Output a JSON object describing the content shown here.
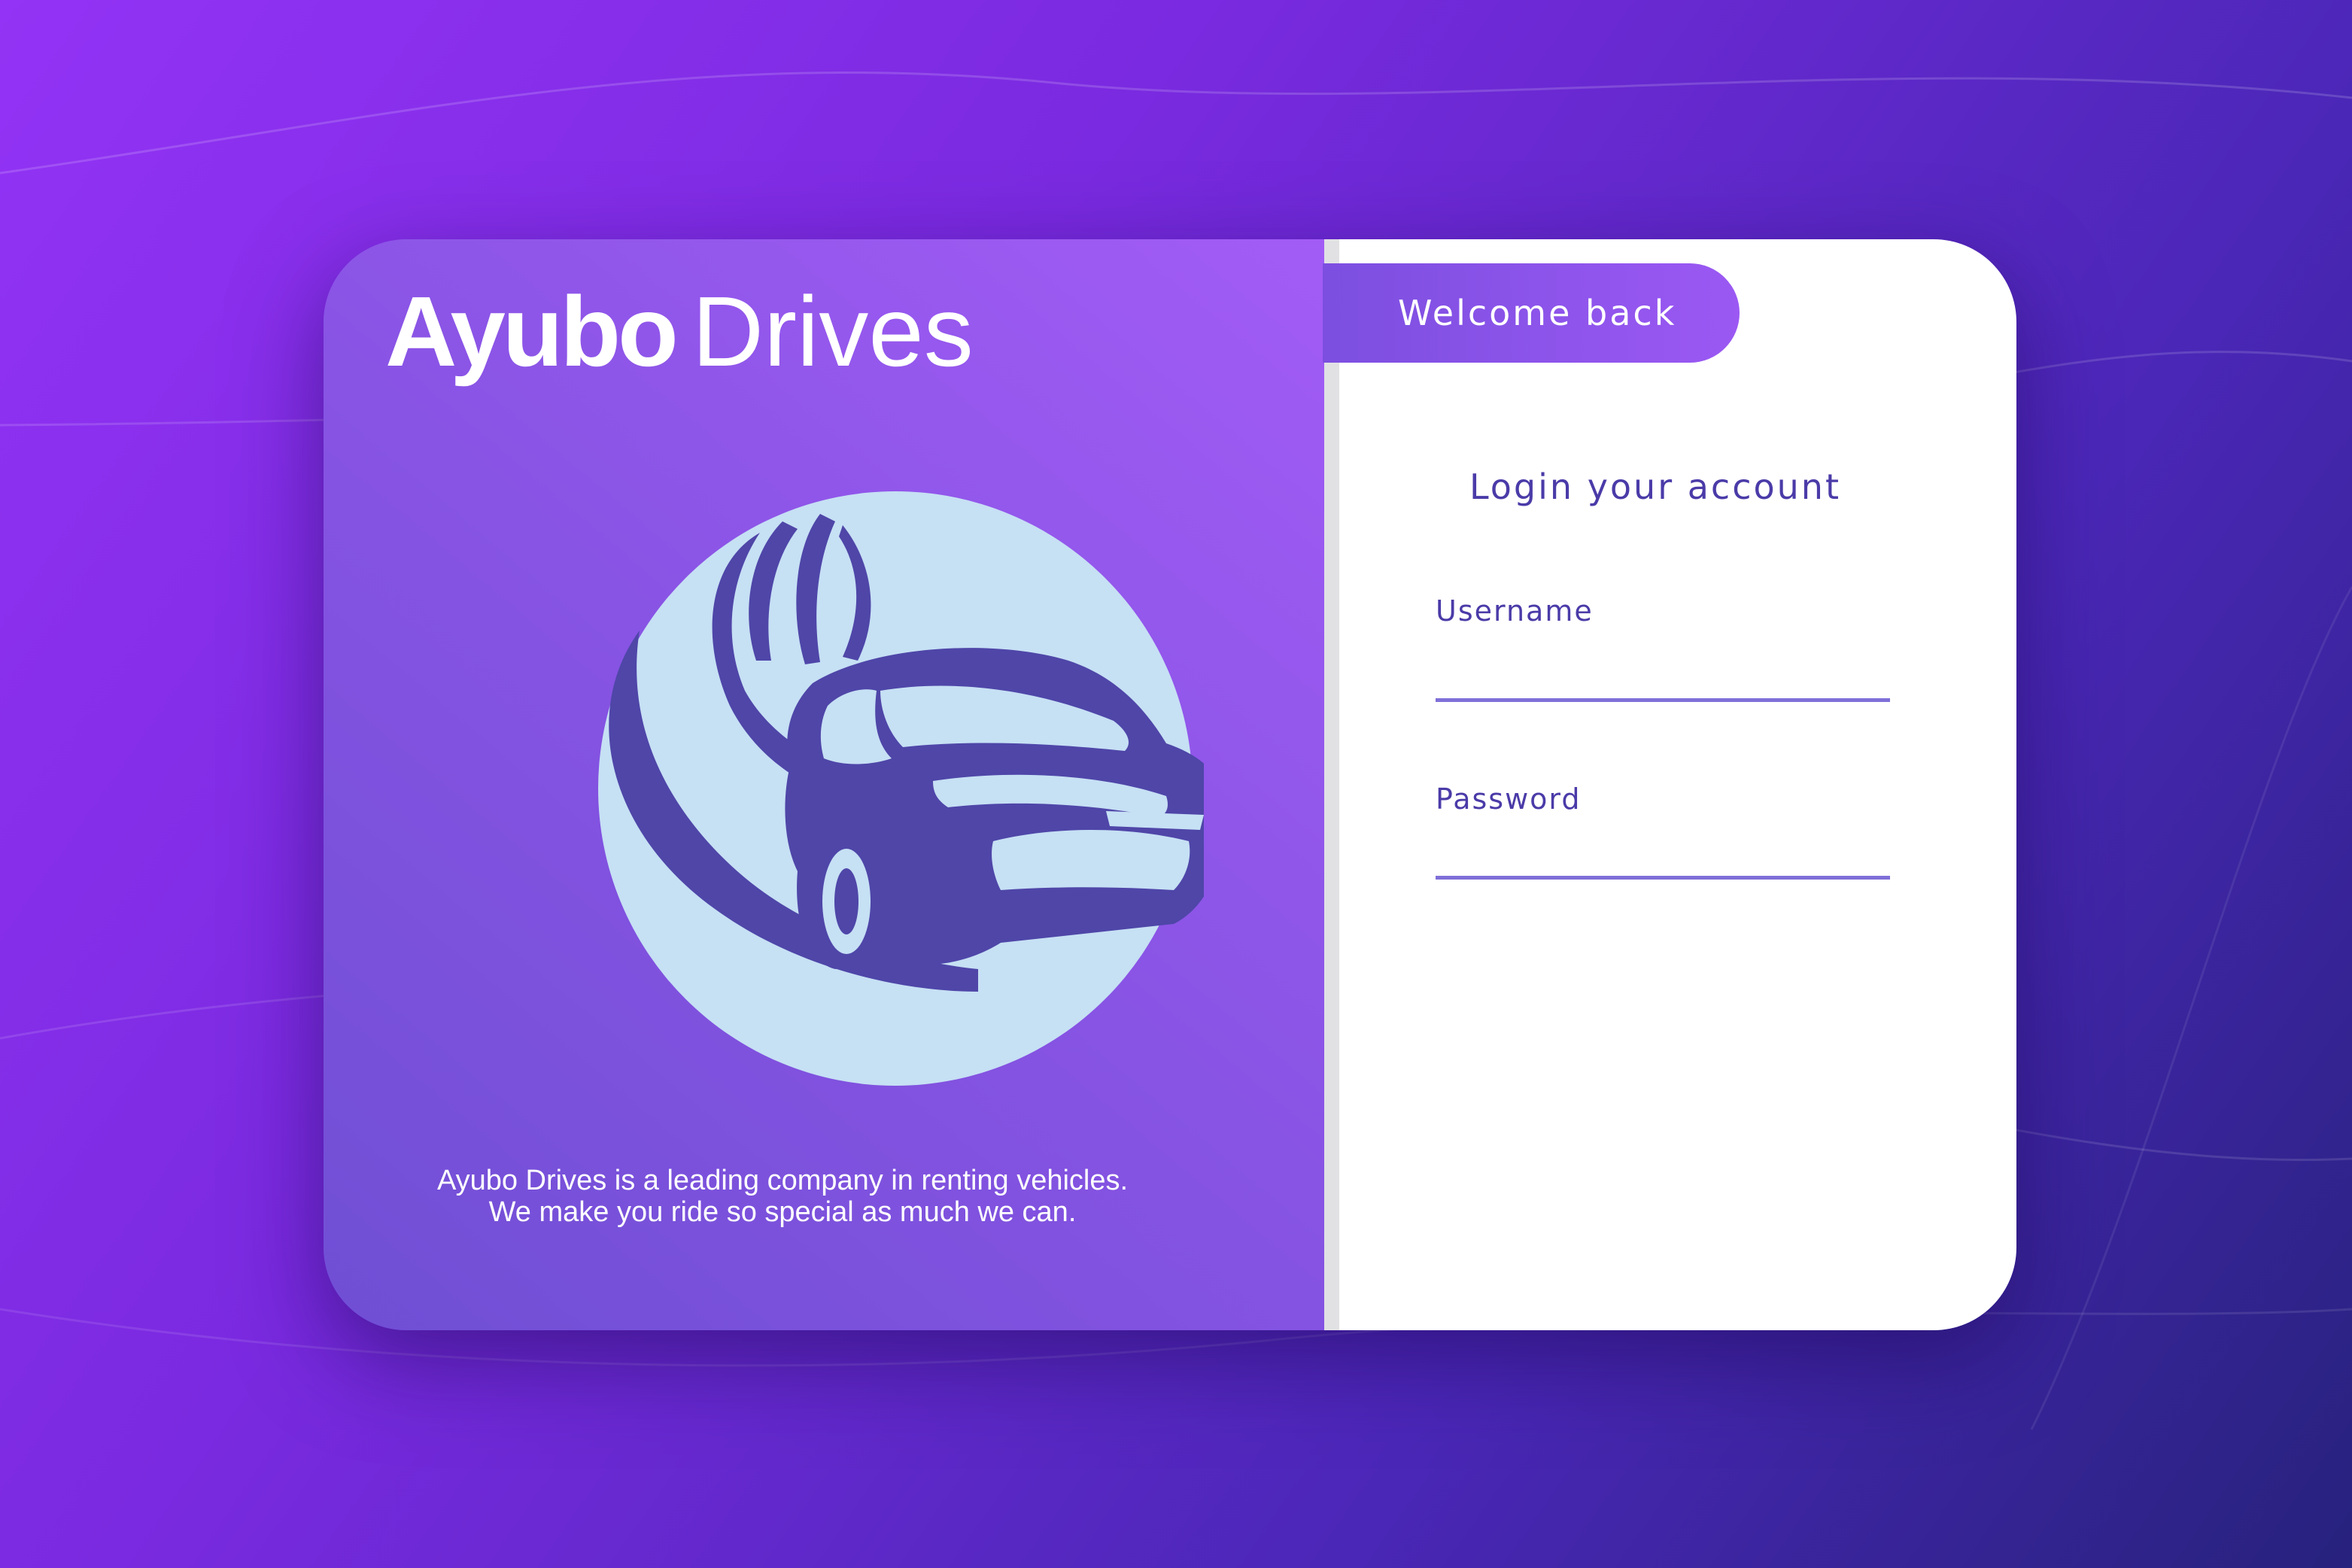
{
  "brand": {
    "name_bold": "Ayubo",
    "name_light": "Drives",
    "tagline": "Ayubo Drives is a leading company in renting vehicles. We make you ride so special as much we can.",
    "logo_icon": "car-logo-icon"
  },
  "login": {
    "welcome_tab": "Welcome back",
    "title": "Login your account",
    "username_label": "Username",
    "username_value": "",
    "password_label": "Password",
    "password_value": ""
  },
  "colors": {
    "accent": "#8b55ea",
    "logo_circle": "#c6e0f4",
    "logo_car": "#4f46a8",
    "text_dark": "#4a3ba8",
    "underline": "#7f6fd8"
  }
}
